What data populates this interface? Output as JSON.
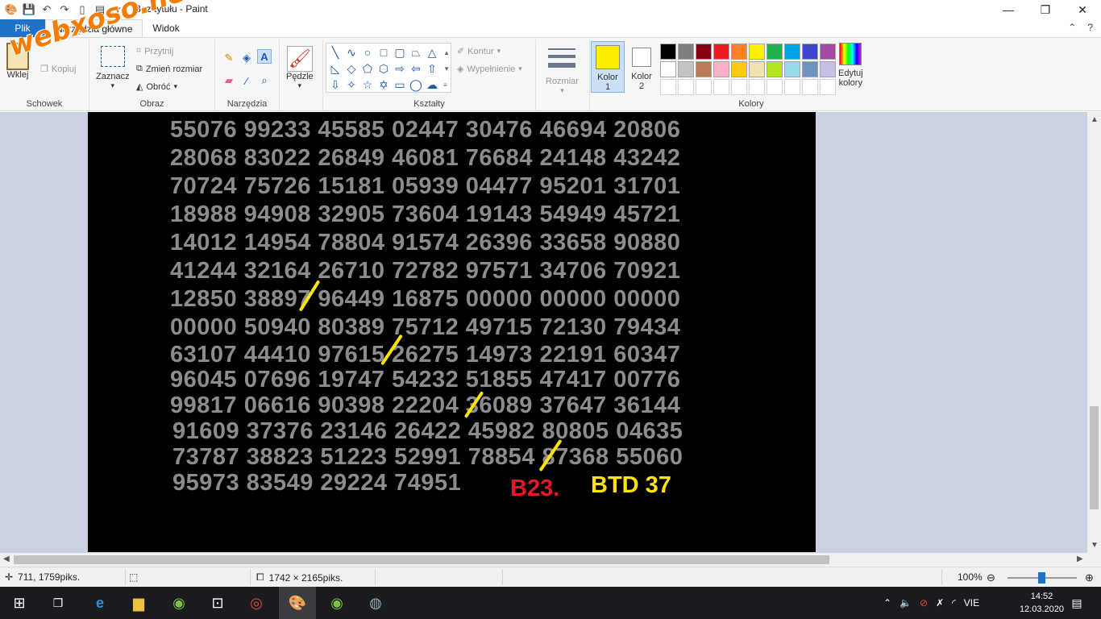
{
  "window": {
    "title": "Bez tytułu - Paint",
    "min_label": "—",
    "max_label": "❐",
    "close_label": "✕"
  },
  "watermark": "webxoso.net",
  "tabs": {
    "file": "Plik",
    "home": "Narzędzia główne",
    "view": "Widok",
    "help_icon": "?"
  },
  "ribbon": {
    "clipboard": {
      "paste": "Wklej",
      "copy": "Kopiuj",
      "group": "Schowek"
    },
    "image": {
      "select": "Zaznacz",
      "crop": "Przytnij",
      "resize": "Zmień rozmiar",
      "rotate": "Obróć",
      "group": "Obraz"
    },
    "tools": {
      "group": "Narzędzia"
    },
    "brushes": {
      "label": "Pędzle"
    },
    "shapes": {
      "outline": "Kontur",
      "fill": "Wypełnienie",
      "group": "Kształty"
    },
    "size": {
      "label": "Rozmiar"
    },
    "color1": {
      "label": "Kolor",
      "num": "1",
      "value": "#ffee00"
    },
    "color2": {
      "label": "Kolor",
      "num": "2",
      "value": "#ffffff"
    },
    "edit_colors": {
      "label1": "Edytuj",
      "label2": "kolory"
    },
    "colors_group": "Kolory",
    "palette": [
      "#000000",
      "#7f7f7f",
      "#880015",
      "#ed1c24",
      "#ff7f27",
      "#fff200",
      "#22b14c",
      "#00a2e8",
      "#3f48cc",
      "#a349a4",
      "#ffffff",
      "#c3c3c3",
      "#b97a57",
      "#ffaec9",
      "#ffc90e",
      "#efe4b0",
      "#b5e61d",
      "#99d9ea",
      "#7092be",
      "#c8bfe7",
      "#ffffff",
      "#ffffff",
      "#ffffff",
      "#ffffff",
      "#ffffff",
      "#ffffff",
      "#ffffff",
      "#ffffff",
      "#ffffff",
      "#ffffff"
    ]
  },
  "image": {
    "rows": [
      "55076 99233 45585 02447 30476 46694 20806",
      "28068 83022 26849 46081 76684 24148 43242",
      "70724 75726 15181 05939 04477 95201 31701",
      "18988 94908 32905 73604 19143 54949 45721",
      "14012 14954 78804 91574 26396 33658 90880",
      "41244 32164 26710 72782 97571 34706 70921",
      "12850 38897 96449 16875 00000 00000 00000",
      "00000 50940 80389 75712 49715 72130 79434",
      "63107 44410 97615 26275 14973 22191 60347",
      "96045 07696 19747 54232 51855 47417 00776",
      "99817 06616 90398 22204 36089 37647 36144",
      "91609 37376 23146 26422 45982 80805 04635",
      "73787 38823 51223 52991 78854 87368 55060",
      "95973 83549 29224 74951"
    ],
    "label_red": "B23.",
    "label_yellow": "BTD 37"
  },
  "status": {
    "cursor": "711, 1759piks.",
    "size": "1742 × 2165piks.",
    "zoom": "100%"
  },
  "taskbar": {
    "lang": "VIE",
    "time": "14:52",
    "date": "12.03.2020"
  }
}
